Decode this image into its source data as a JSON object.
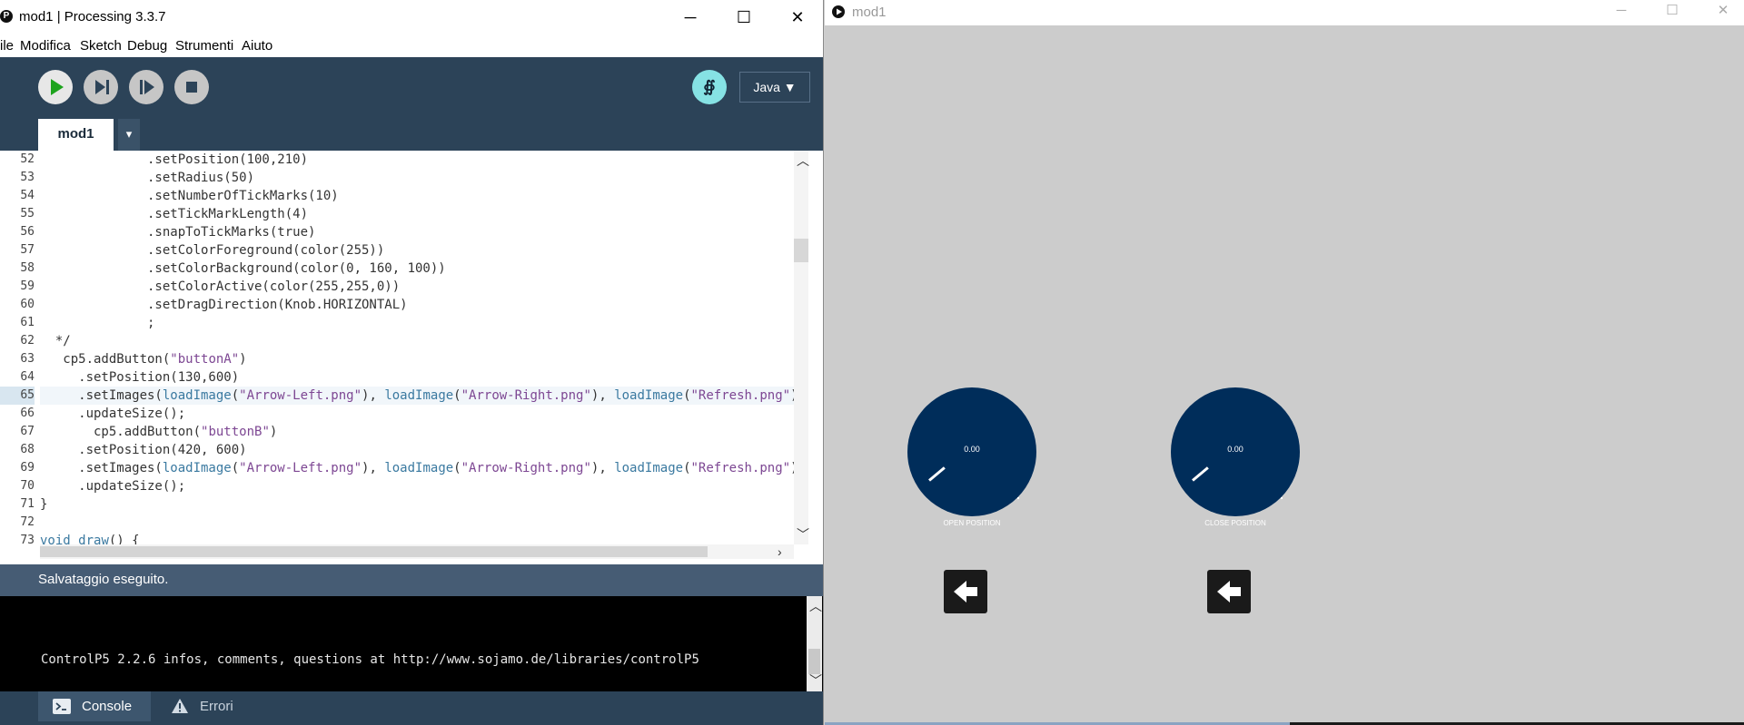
{
  "ide": {
    "title": "mod1 | Processing 3.3.7",
    "icon": "processing-p-icon",
    "window_controls": {
      "minimize": "─",
      "maximize": "☐",
      "close": "✕"
    },
    "menu": [
      "ile",
      "Modifica",
      "Sketch",
      "Debug",
      "Strumenti",
      "Aiuto"
    ],
    "toolbar": {
      "mode_badge": "∯",
      "mode": "Java ▼"
    },
    "tabs": [
      {
        "label": "mod1"
      }
    ],
    "tab_menu": "▾",
    "editor": {
      "line_numbers": [
        "52",
        "53",
        "54",
        "55",
        "56",
        "57",
        "58",
        "59",
        "60",
        "61",
        "62",
        "63",
        "64",
        "65",
        "66",
        "67",
        "68",
        "69",
        "70",
        "71",
        "72",
        "73"
      ],
      "current_line": "65"
    },
    "status": "Salvataggio eseguito.",
    "console_text": "ControlP5 2.2.6 infos, comments, questions at http://www.sojamo.de/libraries/controlP5",
    "bottom_tabs": {
      "console": "Console",
      "errors": "Errori"
    },
    "colors": {
      "toolbar": "#2c4358",
      "status": "#465c74",
      "console_bg": "#000000"
    }
  },
  "sketch": {
    "title": "mod1",
    "window_controls": {
      "minimize": "─",
      "maximize": "☐",
      "close": "✕"
    },
    "knobs": [
      {
        "value": "0.00",
        "caption": "OPEN POSITION"
      },
      {
        "value": "0.00",
        "caption": "CLOSE POSITION"
      }
    ],
    "buttons": [
      "arrow-left-icon",
      "arrow-left-icon"
    ],
    "colors": {
      "background": "#cccccc",
      "knob": "#002d5a"
    }
  }
}
